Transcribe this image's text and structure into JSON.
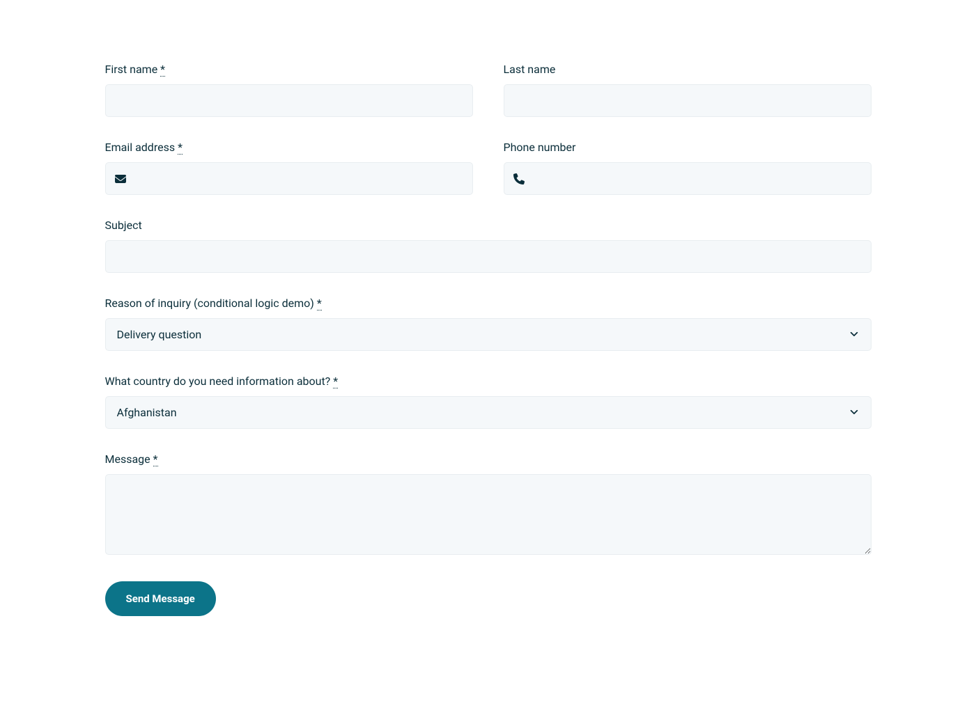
{
  "form": {
    "first_name": {
      "label": "First name",
      "required_mark": "*",
      "value": ""
    },
    "last_name": {
      "label": "Last name",
      "value": ""
    },
    "email": {
      "label": "Email address",
      "required_mark": "*",
      "value": ""
    },
    "phone": {
      "label": "Phone number",
      "value": ""
    },
    "subject": {
      "label": "Subject",
      "value": ""
    },
    "reason": {
      "label": "Reason of inquiry (conditional logic demo)",
      "required_mark": "*",
      "selected": "Delivery question"
    },
    "country": {
      "label": "What country do you need information about?",
      "required_mark": "*",
      "selected": "Afghanistan"
    },
    "message": {
      "label": "Message",
      "required_mark": "*",
      "value": ""
    },
    "submit_label": "Send Message"
  }
}
